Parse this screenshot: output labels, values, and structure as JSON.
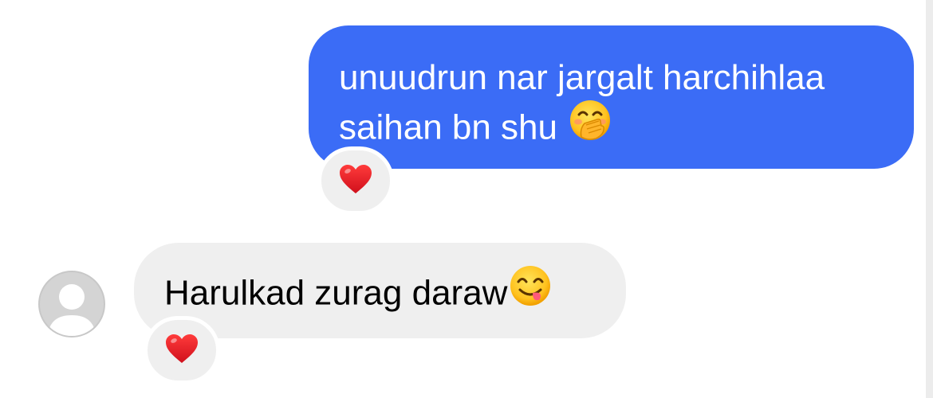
{
  "conversation": {
    "outgoing": {
      "line1": "unuudrun nar jargalt harchihlaa",
      "line2": "saihan bn shu",
      "emoji": "hand-over-mouth-face",
      "reaction": "red-heart"
    },
    "incoming": {
      "text": "Harulkad zurag daraw",
      "emoji": "face-savoring-food",
      "reaction": "red-heart"
    }
  },
  "colors": {
    "outgoing_bubble": "#3b6cf6",
    "incoming_bubble": "#efefef",
    "heart": "#e3202b"
  }
}
